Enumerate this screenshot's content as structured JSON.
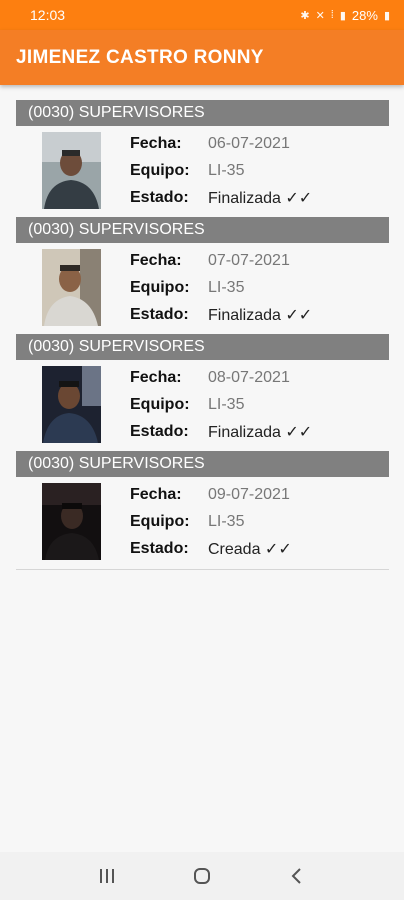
{
  "status_bar": {
    "time": "12:03",
    "battery": "28%",
    "icons": [
      "bluetooth-icon",
      "mute-icon",
      "volte-icon",
      "signal-icon",
      "battery-icon"
    ]
  },
  "app_bar": {
    "title": "JIMENEZ CASTRO RONNY"
  },
  "labels": {
    "fecha": "Fecha:",
    "equipo": "Equipo:",
    "estado": "Estado:"
  },
  "records": [
    {
      "group": "(0030) SUPERVISORES",
      "fecha": "06-07-2021",
      "equipo": "LI-35",
      "estado": "Finalizada ✓✓"
    },
    {
      "group": "(0030) SUPERVISORES",
      "fecha": "07-07-2021",
      "equipo": "LI-35",
      "estado": "Finalizada ✓✓"
    },
    {
      "group": "(0030) SUPERVISORES",
      "fecha": "08-07-2021",
      "equipo": "LI-35",
      "estado": "Finalizada ✓✓"
    },
    {
      "group": "(0030) SUPERVISORES",
      "fecha": "09-07-2021",
      "equipo": "LI-35",
      "estado": "Creada ✓✓"
    }
  ],
  "colors": {
    "accent": "#f47e25",
    "status_bar": "#fd7f10",
    "header_gray": "#808080"
  },
  "nav_bar": {
    "buttons": [
      "recent-apps-icon",
      "home-icon",
      "back-icon"
    ]
  }
}
